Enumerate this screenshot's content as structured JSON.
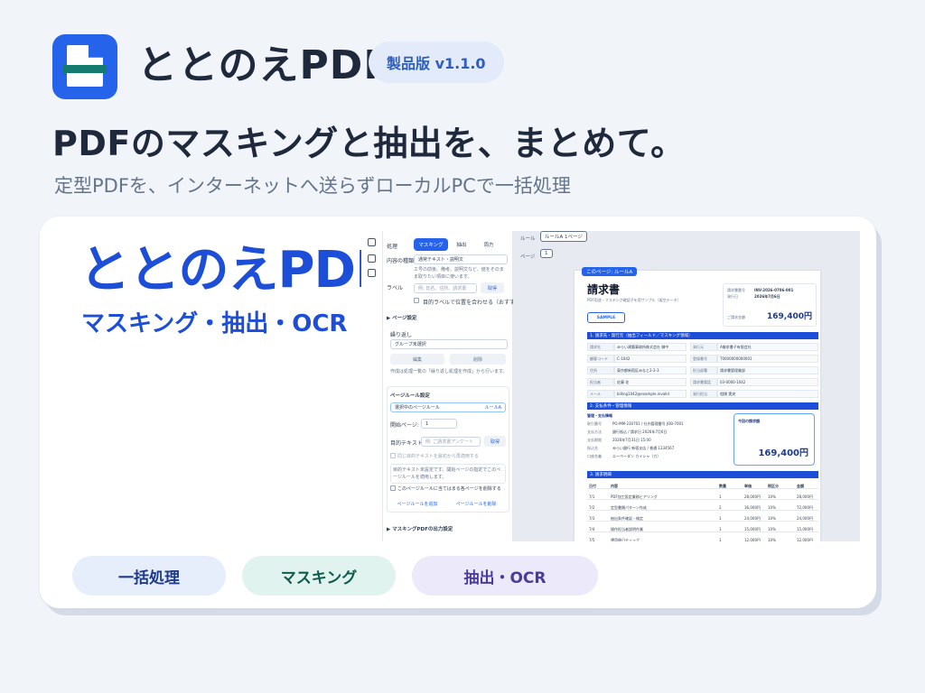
{
  "header": {
    "app_name": "ととのえPDF",
    "version_badge": "製品版 v1.1.0",
    "headline": "PDFのマスキングと抽出を、まとめて。",
    "subline": "定型PDFを、インターネットへ送らずローカルPCで一括処理"
  },
  "card": {
    "promo_title": "ととのえPDF",
    "promo_sub": "マスキング・抽出・OCR",
    "chips": [
      "一括処理",
      "マスキング",
      "抽出・OCR"
    ]
  },
  "colors": {
    "brand": "#2563eb",
    "accent_green": "#157a70",
    "background": "#f1f5fa"
  },
  "icons": {
    "logo": "document-with-mask-band-icon",
    "rail": [
      "file-icon",
      "clipboard-icon",
      "folder-icon"
    ]
  },
  "app": {
    "sidebar": {
      "process_label": "処理",
      "modes": [
        "マスキング",
        "抽出",
        "両方"
      ],
      "content_type_label": "内容の種類",
      "content_type_value": "通常テキスト・説明文",
      "content_hint": "工号の前後、備考、説明文など、値をそのまま取りたい項目に使います。",
      "label_label": "ラベル",
      "label_placeholder": "例: 氏名、住所、請求書",
      "fetch_button": "取得",
      "align_checkbox": "目的ラベルで位置を合わせる（おすすめ）",
      "page_settings": "ページ設定",
      "repeat_label": "繰り返し",
      "repeat_value": "グループ未選択",
      "edit_button": "編集",
      "delete_button": "削除",
      "repeat_hint": "作成は処理一覧の「繰り返し処理を作成」から行います。",
      "page_rule_title": "ページルール設定",
      "selected_rule_label": "選択中のページルール",
      "selected_rule_value": "ルールA",
      "start_page_label": "開始ページ:",
      "start_page_value": "1",
      "target_text_label": "目的テキスト:",
      "target_text_placeholder": "例: ご請求書アンケート",
      "fetch_button_2": "取得",
      "same_target_checkbox": "同じ目的テキストを最初から再適用する",
      "rule_hint": "目的テキスト未設定です。開始ページの指定でこのページルールを適用します。",
      "exclude_checkbox": "このページルールに当てはまる各ページを削除する",
      "add_rule_button": "ページルールを追加",
      "delete_rule_button": "ページルールを削除",
      "output_settings": "マスキングPDFの出力設定"
    },
    "viewer": {
      "rule_label": "ルール",
      "rule_value": "ルールA 1ページ",
      "page_label": "ページ",
      "page_value": "1",
      "overlay_label": "このページ: ルールA",
      "doc_title": "請求書",
      "doc_subtitle": "PDF用途・マスキング確認子を用サンプル（架空データ）",
      "sample_stamp": "SAMPLE",
      "invoice_no_label": "請求書番号",
      "invoice_no": "INV-2026-0706-001",
      "issue_date_label": "発行日",
      "issue_date": "2026年7月6日",
      "total_label": "ご請求金額",
      "total": "169,400円",
      "section1": "1. 請求先・発行元（抽出フィールド／マスキング領域）",
      "fields": [
        [
          "請求先",
          "みらい建築事務所株式会社 御中",
          "発行元",
          "A御求書子有限会社"
        ],
        [
          "顧客コード",
          "C-1042",
          "登録番号",
          "T0000000000001"
        ],
        [
          "住所",
          "東京都新宿区みなと2-2-3",
          "担当部署",
          "請求書管理業部"
        ],
        [
          "担当者",
          "佐藤 花",
          "請求書電話",
          "03-0000-1042"
        ],
        [
          "メール",
          "billing1042@example.invalid",
          "発行担当",
          "相撲 実央"
        ]
      ],
      "section2": "2. 支払条件・管理情報",
      "mgmt_title": "管理・支払情報",
      "mgmt_rows": [
        [
          "取引番号",
          "PO-MM-230701 / 社内管理番号 JOB-7001"
        ],
        [
          "支払方法",
          "銀行振込 / 請求日 2026年7月6日"
        ],
        [
          "支払期限",
          "2026年7月31日 15:00"
        ],
        [
          "振込先",
          "みらい銀行 新宿支店 / 普通 1234567"
        ],
        [
          "口座名義",
          "エーペーダン カイシャ（カ）"
        ]
      ],
      "this_amount_label": "今回の請求額",
      "this_amount": "169,400円",
      "section3": "3. 請求明細",
      "table_headers": [
        "日付",
        "内容",
        "数量",
        "単価",
        "税区分",
        "金額"
      ],
      "table_rows": [
        [
          "7/1",
          "PDF加工設定業務ヒアリング",
          "1",
          "28,000円",
          "10%",
          "28,000円"
        ],
        [
          "7/2",
          "定型書類パターン作成",
          "2",
          "36,000円",
          "10%",
          "72,000円"
        ],
        [
          "7/3",
          "抽出条件確認・検定",
          "1",
          "24,000円",
          "10%",
          "24,000円"
        ],
        [
          "7/4",
          "操作担当者説明作業",
          "1",
          "15,000円",
          "10%",
          "15,000円"
        ],
        [
          "7/5",
          "運用後日チェック",
          "1",
          "12,000円",
          "10%",
          "12,000円"
        ]
      ]
    }
  }
}
